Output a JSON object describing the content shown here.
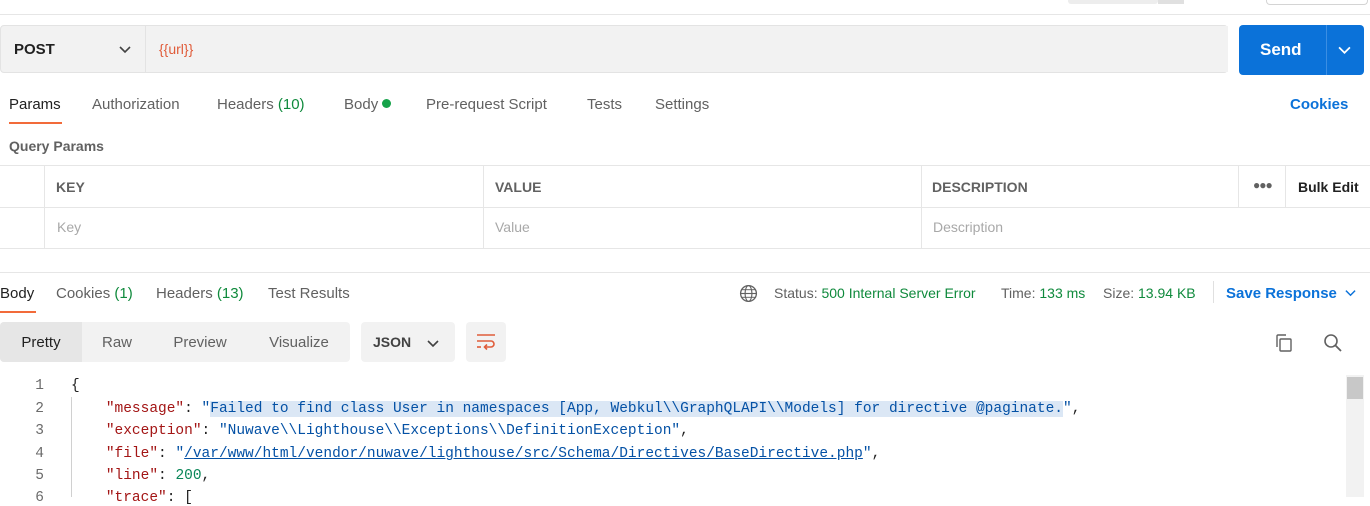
{
  "request": {
    "method": "POST",
    "url": "{{url}}",
    "send_label": "Send"
  },
  "request_tabs": {
    "params": "Params",
    "authorization": "Authorization",
    "headers": "Headers",
    "headers_count": "(10)",
    "body": "Body",
    "prerequest": "Pre-request Script",
    "tests": "Tests",
    "settings": "Settings",
    "cookies": "Cookies"
  },
  "query_params": {
    "title": "Query Params",
    "columns": [
      "KEY",
      "VALUE",
      "DESCRIPTION"
    ],
    "bulk_edit": "Bulk Edit",
    "placeholders": [
      "Key",
      "Value",
      "Description"
    ]
  },
  "response_tabs": {
    "body": "Body",
    "cookies": "Cookies",
    "cookies_count": "(1)",
    "headers": "Headers",
    "headers_count": "(13)",
    "test_results": "Test Results"
  },
  "response_meta": {
    "status_label": "Status:",
    "status_value": "500 Internal Server Error",
    "time_label": "Time:",
    "time_value": "133 ms",
    "size_label": "Size:",
    "size_value": "13.94 KB",
    "save_response": "Save Response"
  },
  "views": {
    "pretty": "Pretty",
    "raw": "Raw",
    "preview": "Preview",
    "visualize": "Visualize",
    "format": "JSON"
  },
  "code": {
    "line_numbers": [
      "1",
      "2",
      "3",
      "4",
      "5",
      "6"
    ],
    "open_brace": "{",
    "message_key": "\"message\"",
    "message_value": "Failed to find class User in namespaces [App, Webkul\\\\GraphQLAPI\\\\Models] for directive @paginate.",
    "exception_key": "\"exception\"",
    "exception_value": "\"Nuwave\\\\Lighthouse\\\\Exceptions\\\\DefinitionException\"",
    "file_key": "\"file\"",
    "file_value": "/var/www/html/vendor/nuwave/lighthouse/src/Schema/Directives/BaseDirective.php",
    "line_key": "\"line\"",
    "line_value": "200",
    "trace_key": "\"trace\"",
    "trace_value": "["
  },
  "colors": {
    "accent_blue": "#0b72d9",
    "tab_underline": "#f26b3a",
    "success_green": "#0f8a3c",
    "url_orange": "#e05c3a"
  }
}
